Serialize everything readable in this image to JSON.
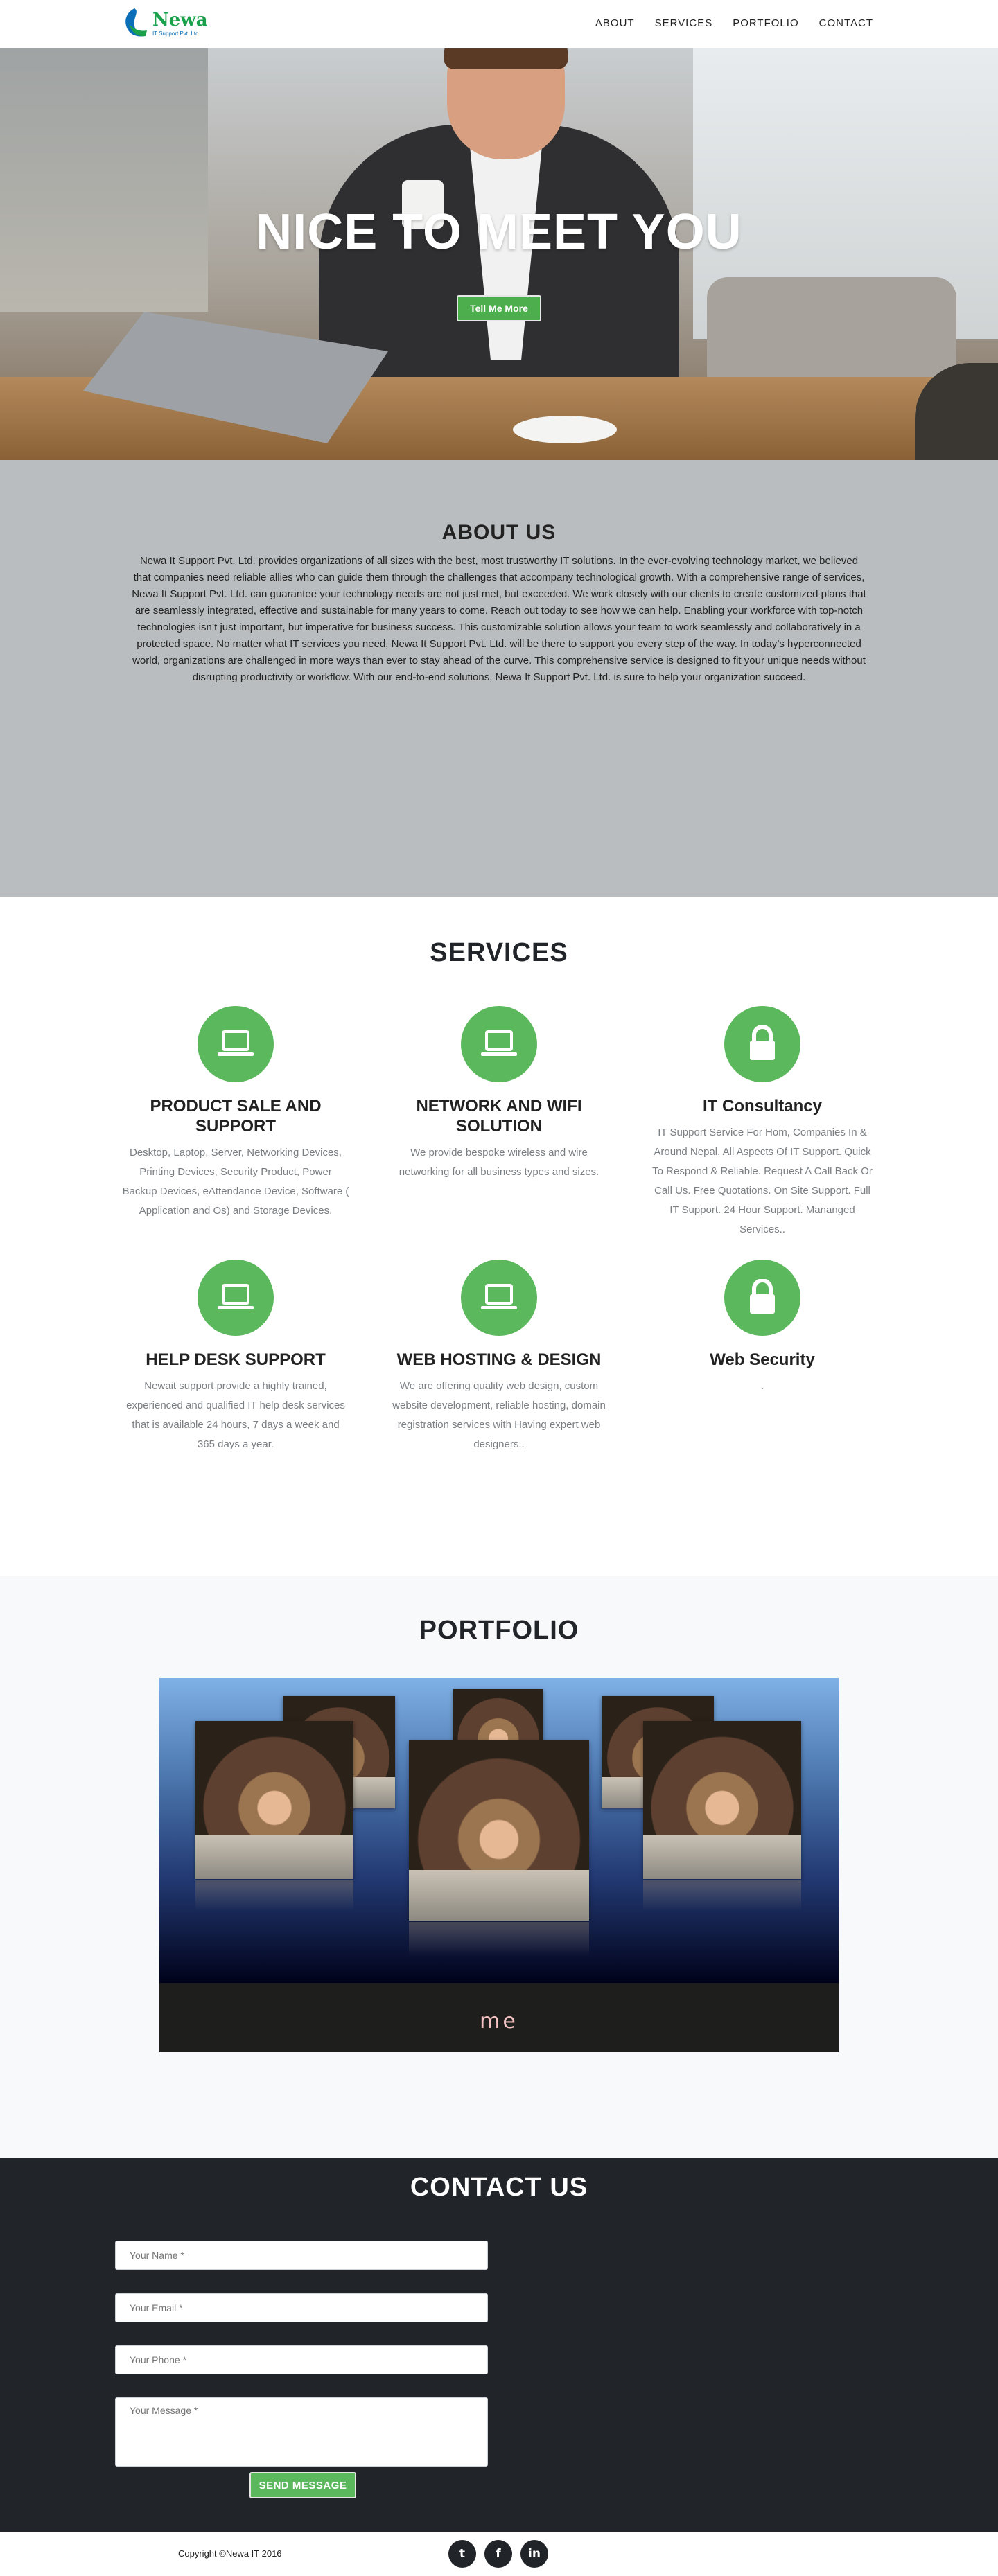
{
  "brand": {
    "name": "Newa",
    "tagline": "IT Support Pvt. Ltd."
  },
  "nav": {
    "items": [
      "ABOUT",
      "SERVICES",
      "PORTFOLIO",
      "CONTACT"
    ]
  },
  "hero": {
    "title": "NICE TO MEET YOU",
    "button": "Tell Me More"
  },
  "about": {
    "title": "ABOUT US",
    "text": "Newa It Support Pvt. Ltd. provides organizations of all sizes with the best, most trustworthy IT solutions. In the ever-evolving technology market, we believed that companies need reliable allies who can guide them through the challenges that accompany technological growth. With a comprehensive range of services, Newa It Support Pvt. Ltd. can guarantee your technology needs are not just met, but exceeded. We work closely with our clients to create customized plans that are seamlessly integrated, effective and sustainable for many years to come. Reach out today to see how we can help. Enabling your workforce with top-notch technologies isn’t just important, but imperative for business success. This customizable solution allows your team to work seamlessly and collaboratively in a protected space. No matter what IT services you need, Newa It Support Pvt. Ltd. will be there to support you every step of the way. In today’s hyperconnected world, organizations are challenged in more ways than ever to stay ahead of the curve. This comprehensive service is designed to fit your unique needs without disrupting productivity or workflow. With our end-to-end solutions, Newa It Support Pvt. Ltd. is sure to help your organization succeed."
  },
  "services": {
    "title": "SERVICES",
    "items": [
      {
        "icon": "laptop-icon",
        "title": "PRODUCT SALE AND SUPPORT",
        "text": "Desktop, Laptop, Server, Networking Devices, Printing Devices, Security Product, Power Backup Devices, eAttendance Device, Software ( Application and Os) and Storage Devices."
      },
      {
        "icon": "laptop-icon",
        "title": "NETWORK AND WIFI SOLUTION",
        "text": "We provide bespoke wireless and wire networking for all business types and sizes."
      },
      {
        "icon": "lock-icon",
        "title": "IT Consultancy",
        "text": "IT Support Service For Hom, Companies In & Around Nepal. All Aspects Of IT Support. Quick To Respond & Reliable. Request A Call Back Or Call Us. Free Quotations. On Site Support. Full IT Support. 24 Hour Support. Mananged Services.."
      },
      {
        "icon": "laptop-icon",
        "title": "HELP DESK SUPPORT",
        "text": "Newait support provide a highly trained, experienced and qualified IT help desk services that is available 24 hours, 7 days a week and 365 days a year."
      },
      {
        "icon": "laptop-icon",
        "title": "WEB HOSTING & DESIGN",
        "text": "We are offering quality web design, custom website development, reliable hosting, domain registration services with Having expert web designers.."
      },
      {
        "icon": "lock-icon",
        "title": "Web Security",
        "text": "."
      }
    ]
  },
  "portfolio": {
    "title": "PORTFOLIO",
    "caption": "me"
  },
  "contact": {
    "title": "CONTACT US",
    "name_placeholder": "Your Name *",
    "email_placeholder": "Your Email *",
    "phone_placeholder": "Your Phone *",
    "message_placeholder": "Your Message *",
    "send": "SEND MESSAGE"
  },
  "footer": {
    "copyright": "Copyright ©Newa IT 2016",
    "social": [
      {
        "icon": "twitter-icon",
        "glyph": "t"
      },
      {
        "icon": "facebook-icon",
        "glyph": "f"
      },
      {
        "icon": "linkedin-icon",
        "glyph": "in"
      }
    ]
  },
  "colors": {
    "accent": "#5cb85c",
    "dark": "#212529",
    "about_bg": "#b9bdbf"
  }
}
